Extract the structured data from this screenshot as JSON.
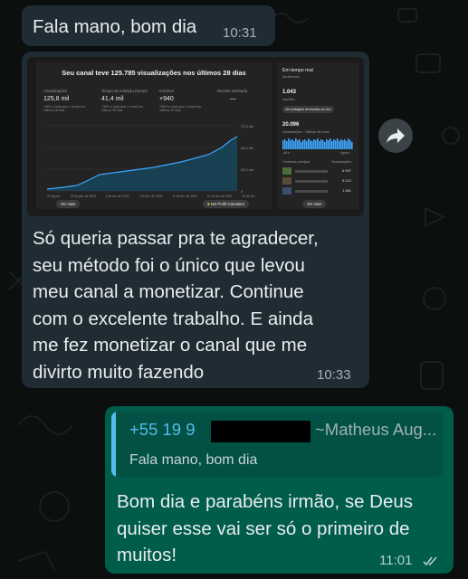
{
  "messages": {
    "first": {
      "text": "Fala mano, bom dia",
      "time": "10:31"
    },
    "second": {
      "text": "Só queria passar pra te agradecer, seu método foi o único que levou meu canal a monetizar. Continue com o excelente trabalho. E ainda me fez monetizar o canal que me divirto muito fazendo",
      "lines": [
        "Só queria passar pra te agradecer,",
        "seu método foi o único que levou",
        "meu canal a monetizar. Continue",
        "com o excelente trabalho. E ainda",
        "me fez monetizar o canal que me",
        "divirto muito fazendo"
      ],
      "time": "10:33",
      "screenshot": {
        "title": "Seu canal teve 125.785 visualizações nos últimos 28 dias",
        "kpis": [
          {
            "label": "Visualizações",
            "value": "125,8 mil",
            "sub": "+96% a mais que o usual nos últimos 28 dias"
          },
          {
            "label": "Tempo de exibição (horas)",
            "value": "41,4 mil",
            "sub": "+96% a mais que o usual nos últimos 28 dias"
          },
          {
            "label": "Inscritos",
            "value": "+940",
            "sub": "+96% a mais que o usual nos últimos 28 dias"
          },
          {
            "label": "Receita estimada",
            "value": "—",
            "sub": ""
          }
        ],
        "y_ticks": [
          "72,5 mil",
          "48,4 mil",
          "24,2 mil",
          "0"
        ],
        "x_ticks": [
          "24 de jan.",
          "29 de jan. de 2024",
          "3 de fev. de 2024",
          "7 de fev. de 2024",
          "11 de fev. de 2024",
          "16 de fev. de 2024",
          "20 de fev."
        ],
        "ver_mais": "Ver mais",
        "calc": "Net Profit Calculator",
        "side": {
          "title": "Em tempo real",
          "status": "Atualizando",
          "count": "1.043",
          "count_label": "Inscritos",
          "live_button": "Ver contagem de inscritos ao vivo",
          "views": "20.096",
          "views_label": "Visualizações · Últimas 48 horas",
          "range_left": "-48 h",
          "range_right": "Agora",
          "top_header": "Conteúdo principal",
          "top_header_right": "Visualizações",
          "rows": [
            "6.997",
            "5.212",
            "1.481"
          ],
          "ver_mais": "Ver mais"
        }
      }
    },
    "third": {
      "quote": {
        "phone": "+55 19 9",
        "sender": "~Matheus Aug...",
        "text": "Fala mano, bom dia"
      },
      "lines": [
        "Bom dia e parabéns irmão, se Deus",
        "quiser esse vai ser só o primeiro de",
        "muitos!"
      ],
      "time": "11:01",
      "status_icon": "double-check-icon"
    }
  },
  "colors": {
    "incoming": "#1f2c33",
    "outgoing": "#005c4b",
    "quote_accent": "#53bdeb"
  }
}
